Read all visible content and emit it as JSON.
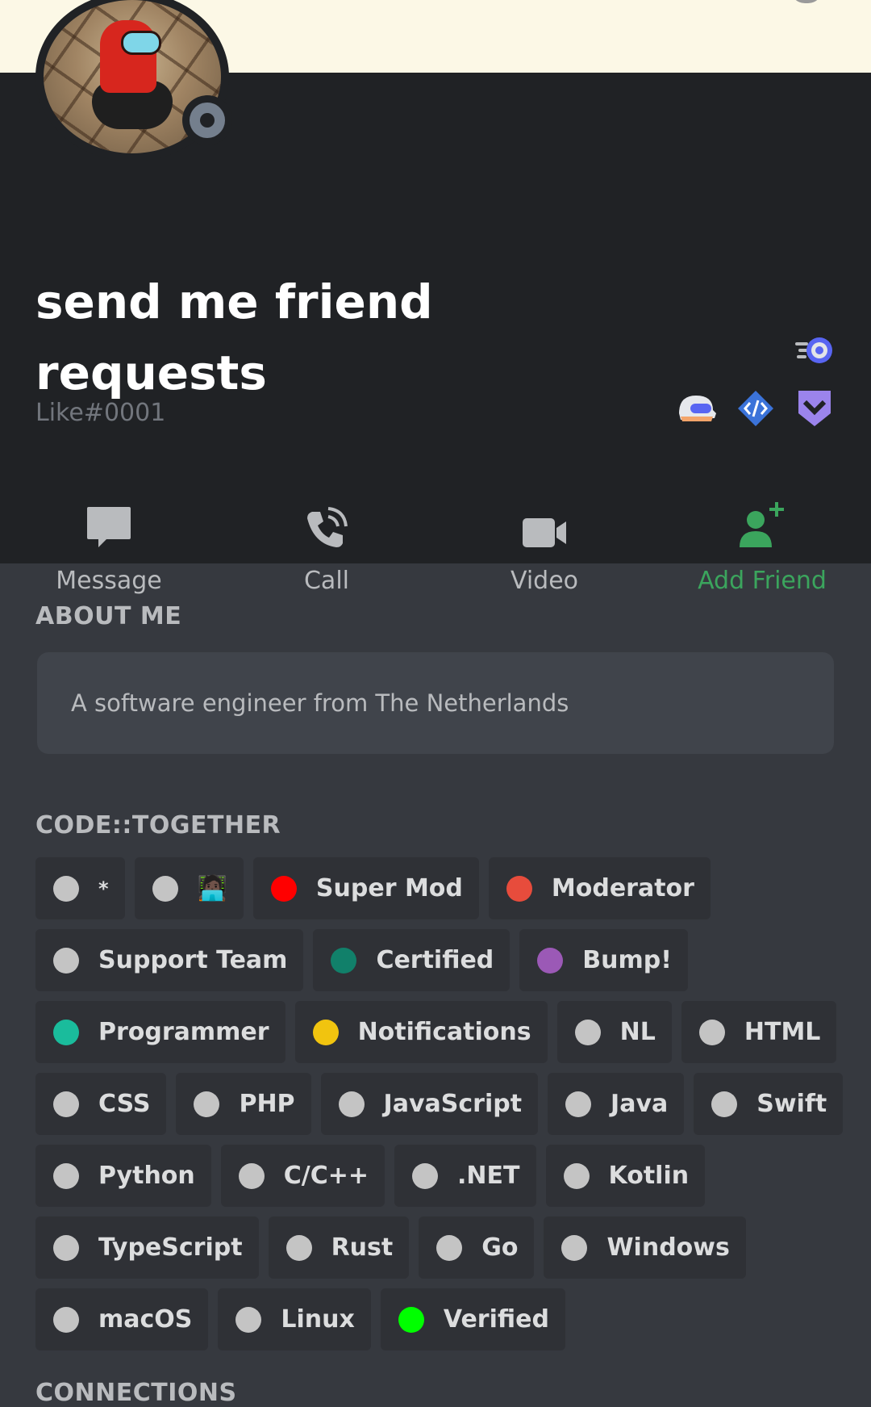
{
  "profile": {
    "username": "send me friend requests",
    "tag": "Like#0001"
  },
  "actions": [
    {
      "label": "Message",
      "icon": "message-icon"
    },
    {
      "label": "Call",
      "icon": "phone-icon"
    },
    {
      "label": "Video",
      "icon": "video-icon"
    },
    {
      "label": "Add Friend",
      "icon": "add-friend-icon"
    }
  ],
  "about_me": {
    "title": "ABOUT ME",
    "text": "A software engineer from The Netherlands"
  },
  "server": {
    "title": "CODE::TOGETHER",
    "roles": [
      [
        {
          "label": "*",
          "color": "#c4c4c4"
        },
        {
          "label": "🧑🏿‍💻",
          "color": "#c4c4c4"
        },
        {
          "label": "Super Mod",
          "color": "#ff0000"
        },
        {
          "label": "Moderator",
          "color": "#e74c3c"
        }
      ],
      [
        {
          "label": "Support Team",
          "color": "#c4c4c4"
        },
        {
          "label": "Certified",
          "color": "#11806a"
        },
        {
          "label": "Bump!",
          "color": "#9b59b6"
        }
      ],
      [
        {
          "label": "Programmer",
          "color": "#1abc9c"
        },
        {
          "label": "Notifications",
          "color": "#f1c40f"
        },
        {
          "label": "NL",
          "color": "#c4c4c4"
        },
        {
          "label": "HTML",
          "color": "#c4c4c4"
        }
      ],
      [
        {
          "label": "CSS",
          "color": "#c4c4c4"
        },
        {
          "label": "PHP",
          "color": "#c4c4c4"
        },
        {
          "label": "JavaScript",
          "color": "#c4c4c4"
        },
        {
          "label": "Java",
          "color": "#c4c4c4"
        },
        {
          "label": "Swift",
          "color": "#c4c4c4"
        }
      ],
      [
        {
          "label": "Python",
          "color": "#c4c4c4"
        },
        {
          "label": "C/C++",
          "color": "#c4c4c4"
        },
        {
          "label": ".NET",
          "color": "#c4c4c4"
        },
        {
          "label": "Kotlin",
          "color": "#c4c4c4"
        }
      ],
      [
        {
          "label": "TypeScript",
          "color": "#c4c4c4"
        },
        {
          "label": "Rust",
          "color": "#c4c4c4"
        },
        {
          "label": "Go",
          "color": "#c4c4c4"
        },
        {
          "label": "Windows",
          "color": "#c4c4c4"
        }
      ],
      [
        {
          "label": "macOS",
          "color": "#c4c4c4"
        },
        {
          "label": "Linux",
          "color": "#c4c4c4"
        },
        {
          "label": "Verified",
          "color": "#00ff00"
        }
      ]
    ]
  },
  "connections": {
    "title": "CONNECTIONS"
  },
  "colors": {
    "header_bg": "#202225",
    "body_bg": "#36393f",
    "add_friend": "#3ba55d",
    "status_offline": "#747f8d"
  },
  "badges": [
    "hypesquad-icon",
    "early-supporter-icon",
    "verified-developer-icon",
    "hypesquad-balance-icon"
  ]
}
